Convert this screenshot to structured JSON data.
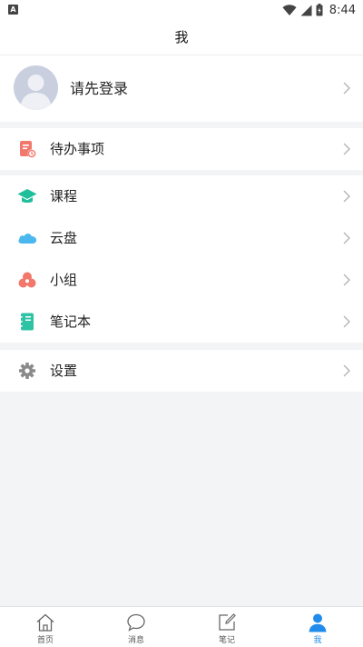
{
  "status_bar": {
    "notification_icon": "A",
    "time": "8:44"
  },
  "header": {
    "title": "我"
  },
  "profile": {
    "login_prompt": "请先登录"
  },
  "menu": {
    "todo": {
      "label": "待办事项",
      "icon": "todo-icon",
      "color": "#f2786b"
    },
    "courses": {
      "label": "课程",
      "icon": "graduation-cap-icon",
      "color": "#1fbf9c"
    },
    "cloud": {
      "label": "云盘",
      "icon": "cloud-icon",
      "color": "#4ab8ef"
    },
    "group": {
      "label": "小组",
      "icon": "group-icon",
      "color": "#f2786b"
    },
    "notebook": {
      "label": "笔记本",
      "icon": "notebook-icon",
      "color": "#2dc3a4"
    },
    "settings": {
      "label": "设置",
      "icon": "gear-icon",
      "color": "#8a8a8a"
    }
  },
  "tabs": [
    {
      "label": "首页",
      "icon": "home-icon",
      "active": false
    },
    {
      "label": "消息",
      "icon": "message-icon",
      "active": false
    },
    {
      "label": "笔记",
      "icon": "note-edit-icon",
      "active": false
    },
    {
      "label": "我",
      "icon": "user-icon",
      "active": true
    }
  ],
  "colors": {
    "accent": "#1f8ceb",
    "background": "#f3f4f6"
  }
}
